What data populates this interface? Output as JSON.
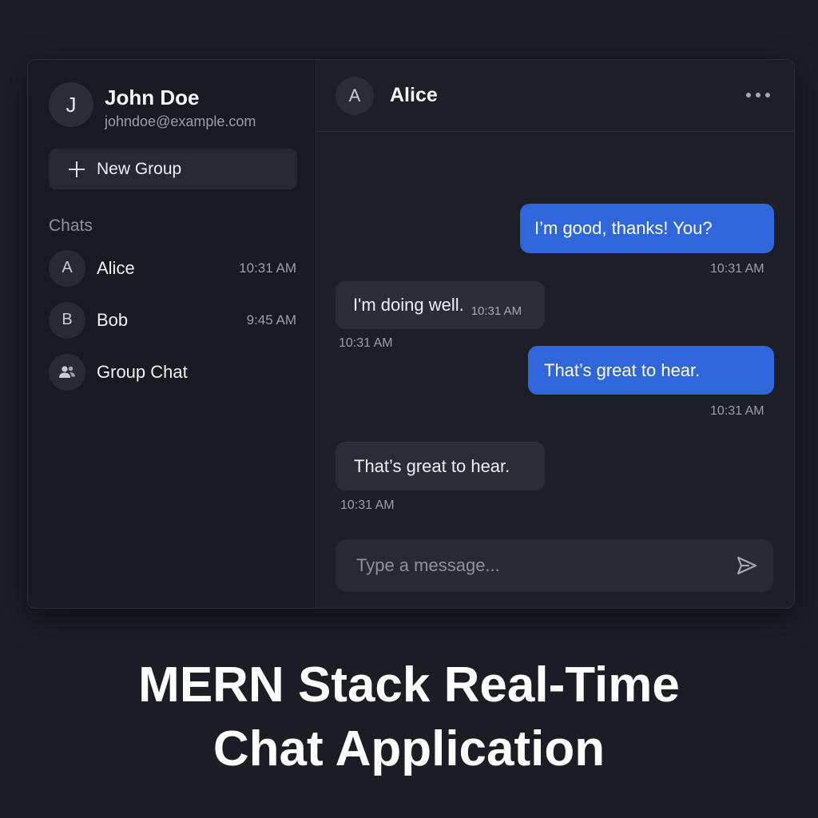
{
  "profile": {
    "initial": "J",
    "name": "John Doe",
    "email": "johndoe@example.com"
  },
  "sidebar": {
    "new_group_label": "New Group",
    "chats_heading": "Chats",
    "items": [
      {
        "initial": "A",
        "name": "Alice",
        "time": "10:31 AM"
      },
      {
        "initial": "B",
        "name": "Bob",
        "time": "9:45 AM"
      },
      {
        "icon": "group-icon",
        "name": "Group Chat",
        "time": ""
      }
    ]
  },
  "conversation": {
    "initial": "A",
    "title": "Alice",
    "menu_icon": "more-horizontal-icon",
    "messages": [
      {
        "direction": "outgoing",
        "text": "I’m good, thanks! You?",
        "time": "10:31 AM"
      },
      {
        "direction": "incoming",
        "text": "I'm doing well.",
        "inline_time": "10:31 AM",
        "time": "10:31 AM"
      },
      {
        "direction": "outgoing",
        "text": "That’s great to hear.",
        "time": "10:31 AM"
      },
      {
        "direction": "incoming",
        "text": "That’s great to hear.",
        "time": "10:31 AM"
      }
    ]
  },
  "composer": {
    "placeholder": "Type a message...",
    "send_icon": "send-icon"
  },
  "caption": {
    "line1": "MERN Stack Real-Time",
    "line2": "Chat Application"
  },
  "colors": {
    "background": "#1b1d25",
    "sidebar": "#181a21",
    "outgoing_bubble": "#2f66d9",
    "incoming_bubble": "#2a2d37"
  }
}
